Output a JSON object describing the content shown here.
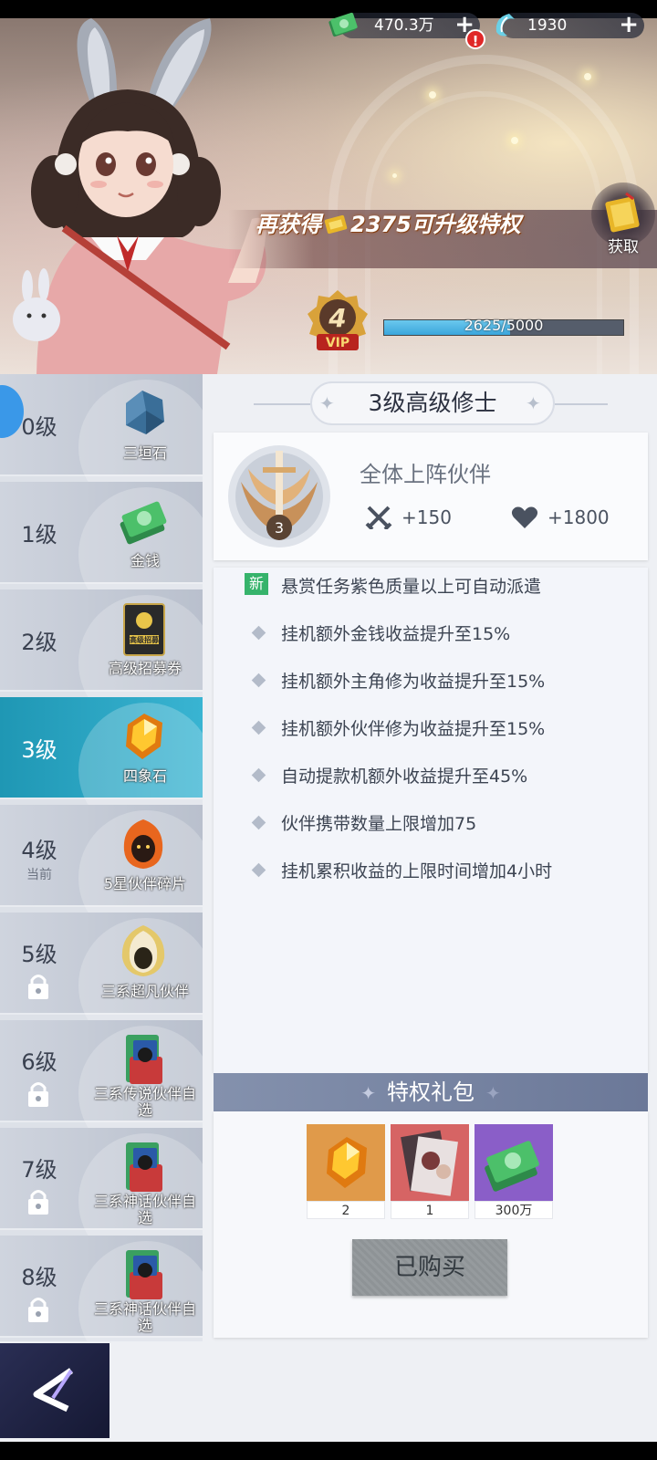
{
  "currency": {
    "money": "470.3万",
    "money_plus": "+",
    "alert": "!",
    "jade": "1930",
    "jade_plus": "+"
  },
  "privilege": {
    "prefix": "再获得",
    "amount_text": "2375可升级特权",
    "get_label": "获取"
  },
  "vip": {
    "level": "4",
    "badge_text": "VIP",
    "progress_text": "2625/5000",
    "progress_fraction": 0.525
  },
  "levels": [
    {
      "label": "0级",
      "sub": "",
      "item": "三垣石",
      "locked": false,
      "active": false
    },
    {
      "label": "1级",
      "sub": "",
      "item": "金钱",
      "locked": false,
      "active": false
    },
    {
      "label": "2级",
      "sub": "",
      "item": "高级招募券",
      "locked": false,
      "active": false
    },
    {
      "label": "3级",
      "sub": "",
      "item": "四象石",
      "locked": false,
      "active": true
    },
    {
      "label": "4级",
      "sub": "当前",
      "item": "5星伙伴碎片",
      "locked": false,
      "active": false
    },
    {
      "label": "5级",
      "sub": "",
      "item": "三系超凡伙伴",
      "locked": true,
      "active": false
    },
    {
      "label": "6级",
      "sub": "",
      "item": "三系传说伙伴自选",
      "locked": true,
      "active": false
    },
    {
      "label": "7级",
      "sub": "",
      "item": "三系神话伙伴自选",
      "locked": true,
      "active": false
    },
    {
      "label": "8级",
      "sub": "",
      "item": "三系神话伙伴自选",
      "locked": true,
      "active": false
    }
  ],
  "level_card_text": "高级招募",
  "detail": {
    "title": "3级高级修士",
    "emblem_level": "3",
    "target": "全体上阵伙伴",
    "attack_bonus": "+150",
    "hp_bonus": "+1800",
    "new_tag": "新",
    "perks": [
      "悬赏任务紫色质量以上可自动派遣",
      "挂机额外金钱收益提升至15%",
      "挂机额外主角修为收益提升至15%",
      "挂机额外伙伴修为收益提升至15%",
      "自动提款机额外收益提升至45%",
      "伙伴携带数量上限增加75",
      "挂机累积收益的上限时间增加4小时"
    ]
  },
  "gift": {
    "title": "特权礼包",
    "items": [
      {
        "icon": "four-symbol-stone-icon",
        "count": "2"
      },
      {
        "icon": "card-pack-icon",
        "count": "1"
      },
      {
        "icon": "money-stack-icon",
        "count": "300万"
      }
    ],
    "button": "已购买"
  },
  "colors": {
    "active_level": "#2aa6c4",
    "vip_fill": "#4ab4e2",
    "new_tag": "#36b36b"
  }
}
